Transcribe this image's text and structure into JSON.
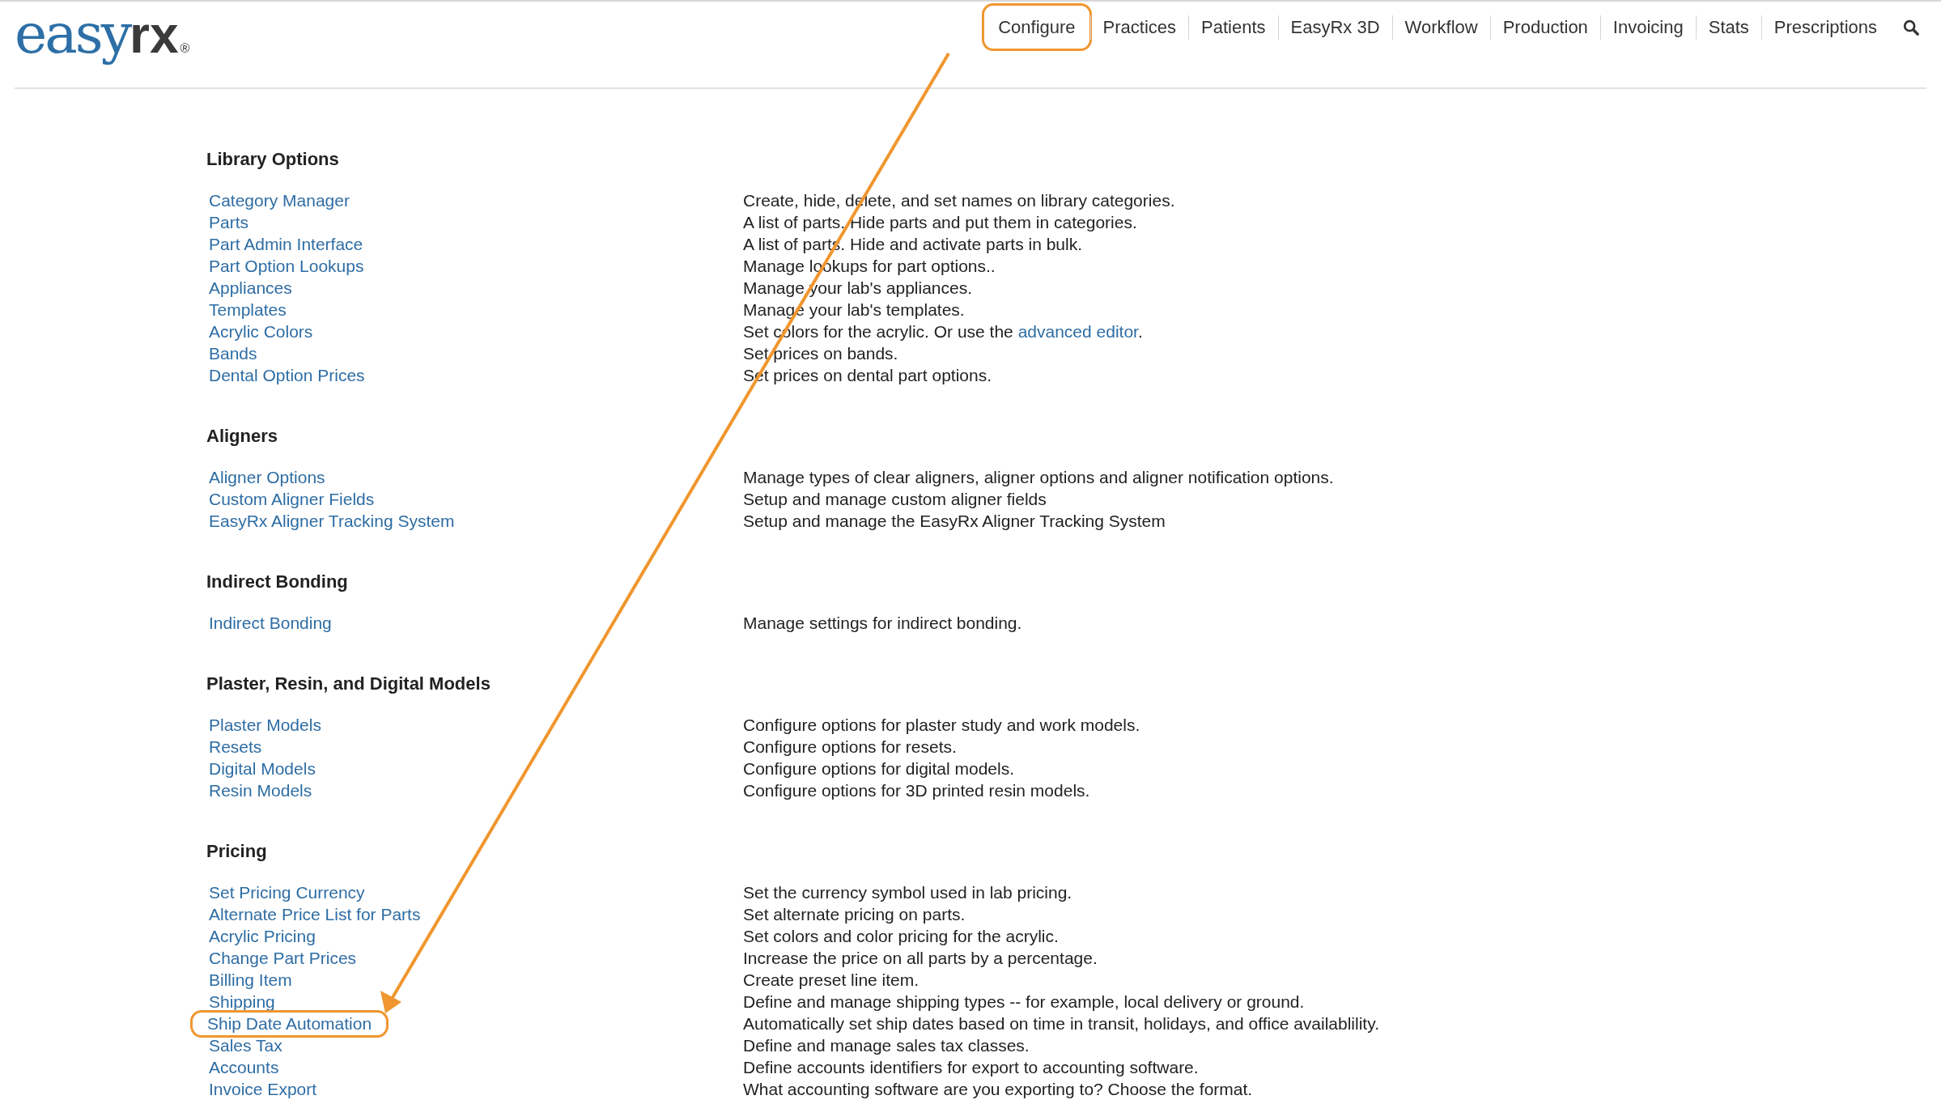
{
  "logo": {
    "part_1": "easy",
    "part_2": "rx",
    "mark": "®"
  },
  "nav": [
    {
      "label": "Configure",
      "highlighted": true
    },
    {
      "label": "Practices",
      "highlighted": false
    },
    {
      "label": "Patients",
      "highlighted": false
    },
    {
      "label": "EasyRx 3D",
      "highlighted": false
    },
    {
      "label": "Workflow",
      "highlighted": false
    },
    {
      "label": "Production",
      "highlighted": false
    },
    {
      "label": "Invoicing",
      "highlighted": false
    },
    {
      "label": "Stats",
      "highlighted": false
    },
    {
      "label": "Prescriptions",
      "highlighted": false
    }
  ],
  "sections": [
    {
      "title": "Library Options",
      "items": [
        {
          "link": "Category Manager",
          "description": "Create, hide, delete, and set names on library categories.",
          "highlighted": false
        },
        {
          "link": "Parts",
          "description": "A list of parts. Hide parts and put them in categories.",
          "highlighted": false
        },
        {
          "link": "Part Admin Interface",
          "description": "A list of parts. Hide and activate parts in bulk.",
          "highlighted": false
        },
        {
          "link": "Part Option Lookups",
          "description": "Manage lookups for part options..",
          "highlighted": false
        },
        {
          "link": "Appliances",
          "description": "Manage your lab's appliances.",
          "highlighted": false
        },
        {
          "link": "Templates",
          "description": "Manage your lab's templates.",
          "highlighted": false
        },
        {
          "link": "Acrylic Colors",
          "description": "Set colors for the acrylic. Or use the ",
          "description_link": "advanced editor",
          "description_end": ".",
          "highlighted": false
        },
        {
          "link": "Bands",
          "description": "Set prices on bands.",
          "highlighted": false
        },
        {
          "link": "Dental Option Prices",
          "description": "Set prices on dental part options.",
          "highlighted": false
        }
      ]
    },
    {
      "title": "Aligners",
      "items": [
        {
          "link": "Aligner Options",
          "description": "Manage types of clear aligners, aligner options and aligner notification options.",
          "highlighted": false
        },
        {
          "link": "Custom Aligner Fields",
          "description": "Setup and manage custom aligner fields",
          "highlighted": false
        },
        {
          "link": "EasyRx Aligner Tracking System",
          "description": "Setup and manage the EasyRx Aligner Tracking System",
          "highlighted": false
        }
      ]
    },
    {
      "title": "Indirect Bonding",
      "items": [
        {
          "link": "Indirect Bonding",
          "description": "Manage settings for indirect bonding.",
          "highlighted": false
        }
      ]
    },
    {
      "title": "Plaster, Resin, and Digital Models",
      "items": [
        {
          "link": "Plaster Models",
          "description": "Configure options for plaster study and work models.",
          "highlighted": false
        },
        {
          "link": "Resets",
          "description": "Configure options for resets.",
          "highlighted": false
        },
        {
          "link": "Digital Models",
          "description": "Configure options for digital models.",
          "highlighted": false
        },
        {
          "link": "Resin Models",
          "description": "Configure options for 3D printed resin models.",
          "highlighted": false
        }
      ]
    },
    {
      "title": "Pricing",
      "items": [
        {
          "link": "Set Pricing Currency",
          "description": "Set the currency symbol used in lab pricing.",
          "highlighted": false
        },
        {
          "link": "Alternate Price List for Parts",
          "description": "Set alternate pricing on parts.",
          "highlighted": false
        },
        {
          "link": "Acrylic Pricing",
          "description": "Set colors and color pricing for the acrylic.",
          "highlighted": false
        },
        {
          "link": "Change Part Prices",
          "description": "Increase the price on all parts by a percentage.",
          "highlighted": false
        },
        {
          "link": "Billing Item",
          "description": "Create preset line item.",
          "highlighted": false
        },
        {
          "link": "Shipping",
          "description": "Define and manage shipping types -- for example, local delivery or ground.",
          "highlighted": false
        },
        {
          "link": "Ship Date Automation",
          "description": "Automatically set ship dates based on time in transit, holidays, and office availablility.",
          "highlighted": true
        },
        {
          "link": "Sales Tax",
          "description": "Define and manage sales tax classes.",
          "highlighted": false
        },
        {
          "link": "Accounts",
          "description": "Define accounts identifiers for export to accounting software.",
          "highlighted": false
        },
        {
          "link": "Invoice Export",
          "description": "What accounting software are you exporting to? Choose the format.",
          "highlighted": false
        }
      ]
    }
  ]
}
